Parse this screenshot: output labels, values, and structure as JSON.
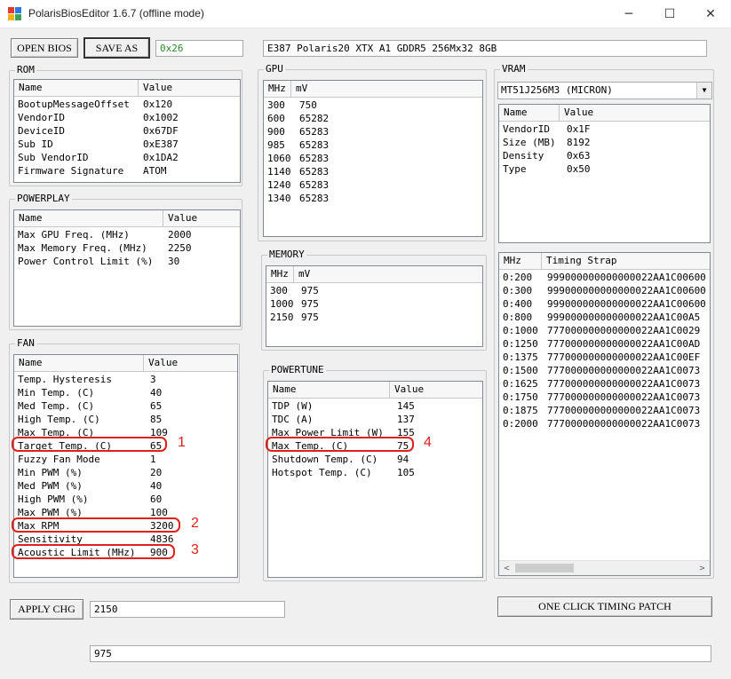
{
  "window": {
    "title": "PolarisBiosEditor 1.6.7 (offline mode)",
    "minimize": "─",
    "maximize": "☐",
    "close": "✕"
  },
  "toolbar": {
    "open_bios": "OPEN BIOS",
    "save_as": "SAVE AS",
    "checksum": "0x26",
    "bios_name": "E387 Polaris20 XTX A1 GDDR5 256Mx32 8GB",
    "checksum_color": "#2a8a2a"
  },
  "rom": {
    "title": "ROM",
    "columns": [
      "Name",
      "Value"
    ],
    "rows": [
      [
        "BootupMessageOffset",
        "0x120"
      ],
      [
        "VendorID",
        "0x1002"
      ],
      [
        "DeviceID",
        "0x67DF"
      ],
      [
        "Sub ID",
        "0xE387"
      ],
      [
        "Sub VendorID",
        "0x1DA2"
      ],
      [
        "Firmware Signature",
        "ATOM"
      ]
    ]
  },
  "powerplay": {
    "title": "POWERPLAY",
    "columns": [
      "Name",
      "Value"
    ],
    "rows": [
      [
        "Max GPU Freq. (MHz)",
        "2000"
      ],
      [
        "Max Memory Freq. (MHz)",
        "2250"
      ],
      [
        "Power Control Limit (%)",
        "30"
      ]
    ]
  },
  "fan": {
    "title": "FAN",
    "columns": [
      "Name",
      "Value"
    ],
    "rows": [
      [
        "Temp. Hysteresis",
        "3"
      ],
      [
        "Min Temp. (C)",
        "40"
      ],
      [
        "Med Temp. (C)",
        "65"
      ],
      [
        "High Temp. (C)",
        "85"
      ],
      [
        "Max Temp. (C)",
        "109"
      ],
      [
        "Target Temp. (C)",
        "65"
      ],
      [
        "Fuzzy Fan Mode",
        "1"
      ],
      [
        "Min PWM (%)",
        "20"
      ],
      [
        "Med PWM (%)",
        "40"
      ],
      [
        "High PWM (%)",
        "60"
      ],
      [
        "Max PWM (%)",
        "100"
      ],
      [
        "Max RPM",
        "3200"
      ],
      [
        "Sensitivity",
        "4836"
      ],
      [
        "Acoustic Limit (MHz)",
        "900"
      ]
    ]
  },
  "gpu": {
    "title": "GPU",
    "columns": [
      "MHz",
      "mV"
    ],
    "rows": [
      [
        "300",
        "750"
      ],
      [
        "600",
        "65282"
      ],
      [
        "900",
        "65283"
      ],
      [
        "985",
        "65283"
      ],
      [
        "1060",
        "65283"
      ],
      [
        "1140",
        "65283"
      ],
      [
        "1240",
        "65283"
      ],
      [
        "1340",
        "65283"
      ]
    ]
  },
  "memory": {
    "title": "MEMORY",
    "columns": [
      "MHz",
      "mV"
    ],
    "rows": [
      [
        "300",
        "975"
      ],
      [
        "1000",
        "975"
      ],
      [
        "2150",
        "975"
      ]
    ]
  },
  "powertune": {
    "title": "POWERTUNE",
    "columns": [
      "Name",
      "Value"
    ],
    "rows": [
      [
        "TDP (W)",
        "145"
      ],
      [
        "TDC (A)",
        "137"
      ],
      [
        "Max Power Limit (W)",
        "155"
      ],
      [
        "Max Temp. (C)",
        "75"
      ],
      [
        "Shutdown Temp. (C)",
        "94"
      ],
      [
        "Hotspot Temp. (C)",
        "105"
      ]
    ]
  },
  "vram": {
    "title": "VRAM",
    "selected_chip": "MT51J256M3 (MICRON)",
    "columns": [
      "Name",
      "Value"
    ],
    "rows": [
      [
        "VendorID",
        "0x1F"
      ],
      [
        "Size (MB)",
        "8192"
      ],
      [
        "Density",
        "0x63"
      ],
      [
        "Type",
        "0x50"
      ]
    ],
    "timing_columns": [
      "MHz",
      "Timing Strap"
    ],
    "timing_rows": [
      [
        "0:200",
        "999000000000000022AA1C00600"
      ],
      [
        "0:300",
        "999000000000000022AA1C00600"
      ],
      [
        "0:400",
        "999000000000000022AA1C00600"
      ],
      [
        "0:800",
        "999000000000000022AA1C00A5"
      ],
      [
        "0:1000",
        "777000000000000022AA1C0029"
      ],
      [
        "0:1250",
        "777000000000000022AA1C00AD"
      ],
      [
        "0:1375",
        "777000000000000022AA1C00EF"
      ],
      [
        "0:1500",
        "777000000000000022AA1C0073"
      ],
      [
        "0:1625",
        "777000000000000022AA1C0073"
      ],
      [
        "0:1750",
        "777000000000000022AA1C0073"
      ],
      [
        "0:1875",
        "777000000000000022AA1C0073"
      ],
      [
        "0:2000",
        "777000000000000022AA1C0073"
      ]
    ]
  },
  "bottom": {
    "apply_chg": "APPLY CHG",
    "edit_value": "2150",
    "one_click": "ONE CLICK TIMING PATCH",
    "edit_value2": "975"
  },
  "annotations": {
    "color": "#e0201a",
    "labels": [
      "1",
      "2",
      "3",
      "4"
    ]
  }
}
